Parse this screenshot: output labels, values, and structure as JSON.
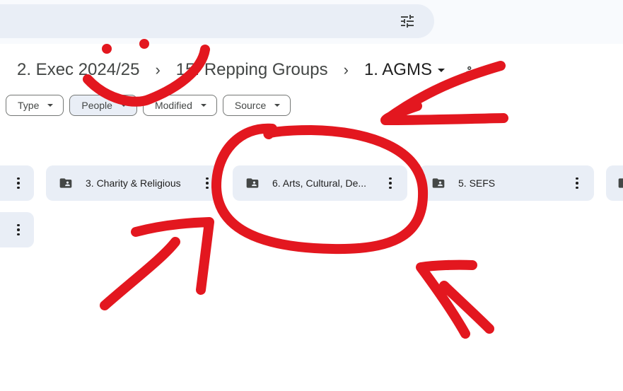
{
  "search": {
    "filter_icon": "tune-icon"
  },
  "breadcrumb": {
    "items": [
      "2. Exec 2024/25",
      "15. Repping Groups",
      "1. AGMS"
    ],
    "separator": "›",
    "current_caret_icon": "caret-down-icon",
    "share_icon": "shared-people-icon"
  },
  "filters": [
    {
      "label": "Type"
    },
    {
      "label": "People"
    },
    {
      "label": "Modified"
    },
    {
      "label": "Source"
    }
  ],
  "folders": [
    {
      "name": "",
      "icon": "shared-folder-icon"
    },
    {
      "name": "3. Charity & Religious",
      "icon": "shared-folder-icon"
    },
    {
      "name": "6. Arts, Cultural, De...",
      "icon": "shared-folder-icon"
    },
    {
      "name": "5. SEFS",
      "icon": "shared-folder-icon"
    },
    {
      "name": "",
      "icon": "shared-folder-icon"
    },
    {
      "name": "",
      "icon": "shared-folder-icon"
    }
  ],
  "colors": {
    "annotation": "#e3171f",
    "card_bg": "#e9eef6",
    "page_bg": "#ffffff"
  }
}
